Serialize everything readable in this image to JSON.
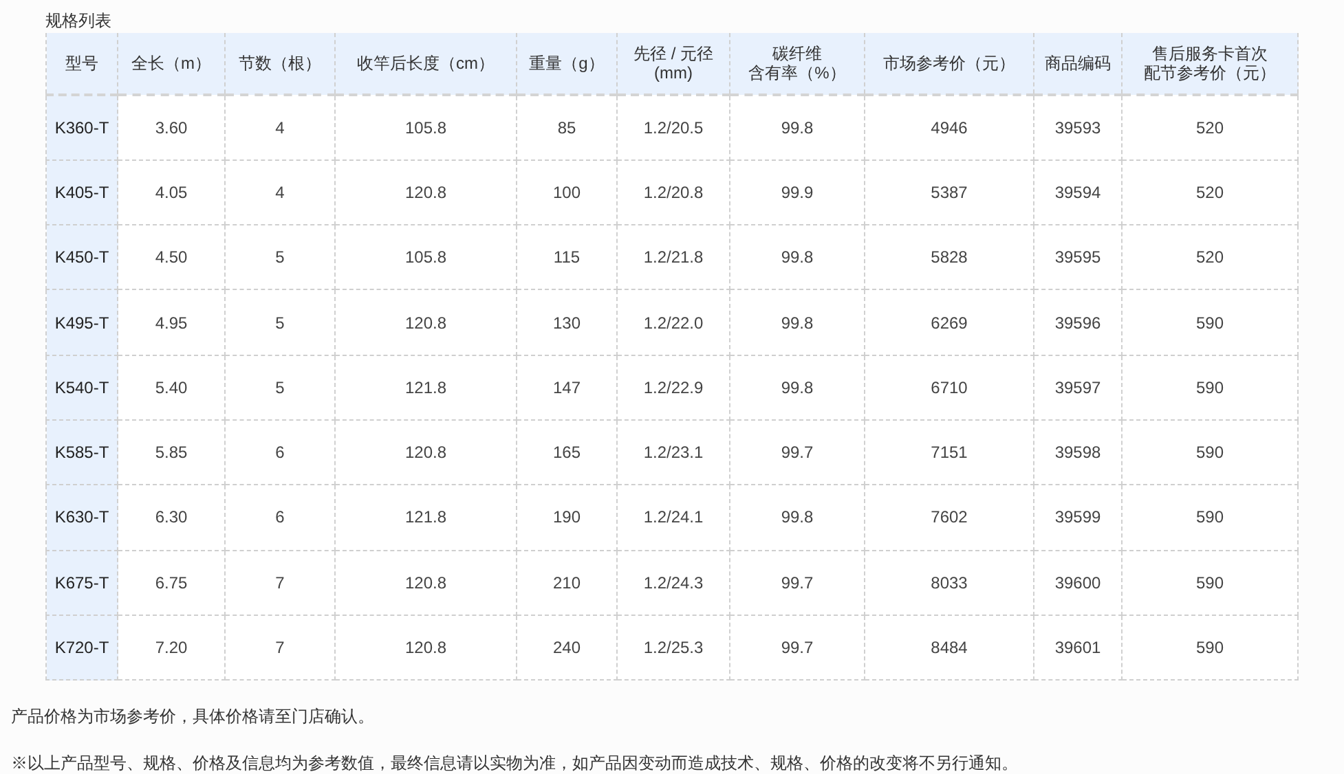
{
  "title": "规格列表",
  "table": {
    "columns": [
      "型号",
      "全长（m）",
      "节数（根）",
      "收竿后长度（cm）",
      "重量（g）",
      "先径 / 元径 (mm)",
      "碳纤维含有率（%）",
      "市场参考价（元）",
      "商品编码",
      "售后服务卡首次配节参考价（元）"
    ],
    "rows": [
      [
        "K360-T",
        "3.60",
        "4",
        "105.8",
        "85",
        "1.2/20.5",
        "99.8",
        "4946",
        "39593",
        "520"
      ],
      [
        "K405-T",
        "4.05",
        "4",
        "120.8",
        "100",
        "1.2/20.8",
        "99.9",
        "5387",
        "39594",
        "520"
      ],
      [
        "K450-T",
        "4.50",
        "5",
        "105.8",
        "115",
        "1.2/21.8",
        "99.8",
        "5828",
        "39595",
        "520"
      ],
      [
        "K495-T",
        "4.95",
        "5",
        "120.8",
        "130",
        "1.2/22.0",
        "99.8",
        "6269",
        "39596",
        "590"
      ],
      [
        "K540-T",
        "5.40",
        "5",
        "121.8",
        "147",
        "1.2/22.9",
        "99.8",
        "6710",
        "39597",
        "590"
      ],
      [
        "K585-T",
        "5.85",
        "6",
        "120.8",
        "165",
        "1.2/23.1",
        "99.7",
        "7151",
        "39598",
        "590"
      ],
      [
        "K630-T",
        "6.30",
        "6",
        "121.8",
        "190",
        "1.2/24.1",
        "99.8",
        "7602",
        "39599",
        "590"
      ],
      [
        "K675-T",
        "6.75",
        "7",
        "120.8",
        "210",
        "1.2/24.3",
        "99.7",
        "8033",
        "39600",
        "590"
      ],
      [
        "K720-T",
        "7.20",
        "7",
        "120.8",
        "240",
        "1.2/25.3",
        "99.7",
        "8484",
        "39601",
        "590"
      ]
    ]
  },
  "notes": [
    "产品价格为市场参考价，具体价格请至门店确认。",
    "※以上产品型号、规格、价格及信息均为参考数值，最终信息请以实物为准，如产品因变动而造成技术、规格、价格的改变将不另行通知。"
  ]
}
